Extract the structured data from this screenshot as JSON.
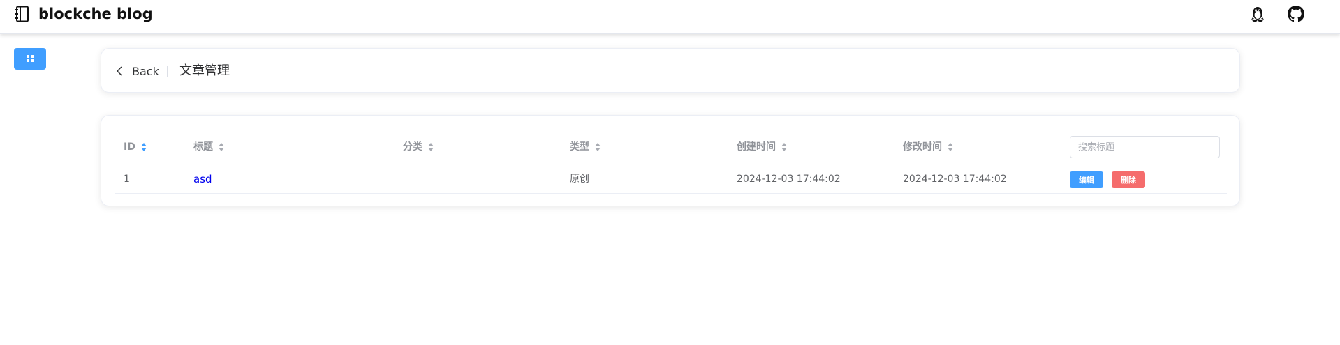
{
  "brand": {
    "title": "blockche blog"
  },
  "header": {
    "back_label": "Back",
    "page_title": "文章管理"
  },
  "table": {
    "columns": [
      "ID",
      "标题",
      "分类",
      "类型",
      "创建时间",
      "修改时间"
    ],
    "search_placeholder": "搜索标题",
    "rows": [
      {
        "id": "1",
        "title": "asd",
        "category": "",
        "type": "原创",
        "created": "2024-12-03 17:44:02",
        "modified": "2024-12-03 17:44:02",
        "edit_label": "编辑",
        "delete_label": "删除"
      }
    ]
  },
  "icons": {
    "brand": "notebook-icon",
    "qq": "qq-penguin-icon",
    "github": "github-icon",
    "menu": "grid-menu-icon",
    "back": "chevron-left-icon",
    "sort": "sort-caret-icon"
  },
  "colors": {
    "primary": "#409eff",
    "danger": "#f56c6c",
    "link": "#0000ee",
    "header_text": "#909399"
  }
}
